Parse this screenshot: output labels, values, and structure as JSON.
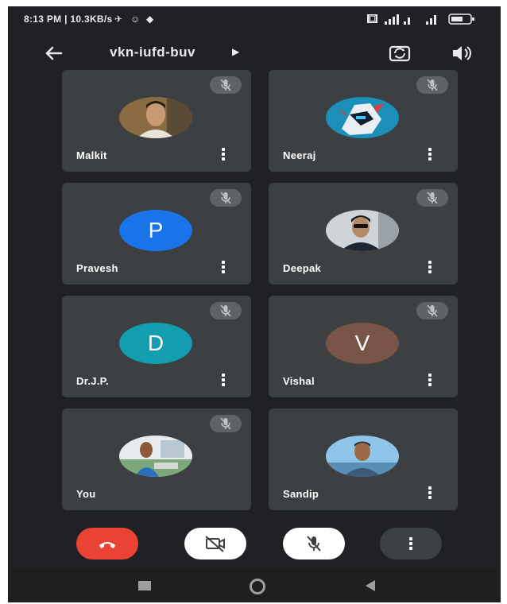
{
  "status_bar": {
    "time": "8:13 PM",
    "net_speed": "10.3KB/s"
  },
  "app_bar": {
    "title": "vkn-iufd-buv",
    "back_icon": "arrow-left-icon",
    "switch_camera_icon": "switch-camera-icon",
    "speaker_icon": "speaker-icon"
  },
  "participants": [
    {
      "name": "Malkit",
      "avatar": "photo",
      "muted": true,
      "has_menu": true
    },
    {
      "name": "Neeraj",
      "avatar": "photo",
      "muted": true,
      "has_menu": true
    },
    {
      "name": "Pravesh",
      "avatar_letter": "P",
      "avatar_color": "#1a73e8",
      "muted": true,
      "has_menu": true
    },
    {
      "name": "Deepak",
      "avatar": "photo",
      "muted": true,
      "has_menu": true
    },
    {
      "name": "Dr.J.P.",
      "avatar_letter": "D",
      "avatar_color": "#129eaf",
      "muted": true,
      "has_menu": true
    },
    {
      "name": "Vishal",
      "avatar_letter": "V",
      "avatar_color": "#795548",
      "muted": true,
      "has_menu": true
    },
    {
      "name": "You",
      "avatar": "photo",
      "muted": true,
      "has_menu": false
    },
    {
      "name": "Sandip",
      "avatar": "photo",
      "muted": false,
      "has_menu": true
    }
  ],
  "controls": {
    "end_call_color": "#ea4335",
    "end_call_icon": "hang-up-icon",
    "camera_icon": "camera-off-icon",
    "mic_icon": "mic-off-icon",
    "more_icon": "more-vert-icon"
  }
}
